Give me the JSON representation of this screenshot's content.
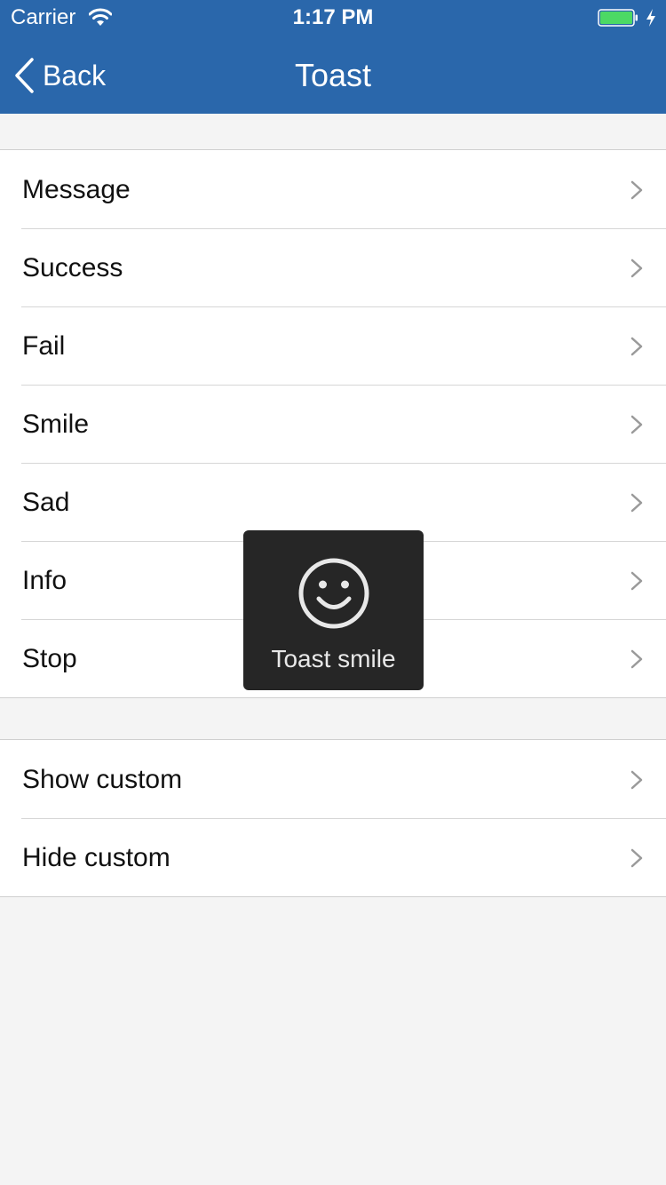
{
  "status_bar": {
    "carrier": "Carrier",
    "time": "1:17 PM",
    "battery_color": "#4cd964"
  },
  "nav": {
    "back_label": "Back",
    "title": "Toast"
  },
  "list_group_1": [
    {
      "label": "Message"
    },
    {
      "label": "Success"
    },
    {
      "label": "Fail"
    },
    {
      "label": "Smile"
    },
    {
      "label": "Sad"
    },
    {
      "label": "Info"
    },
    {
      "label": "Stop"
    }
  ],
  "list_group_2": [
    {
      "label": "Show custom"
    },
    {
      "label": "Hide custom"
    }
  ],
  "toast": {
    "icon": "smile-icon",
    "text": "Toast smile"
  },
  "theme": {
    "nav_color": "#2a67ab",
    "background": "#f4f4f4"
  }
}
